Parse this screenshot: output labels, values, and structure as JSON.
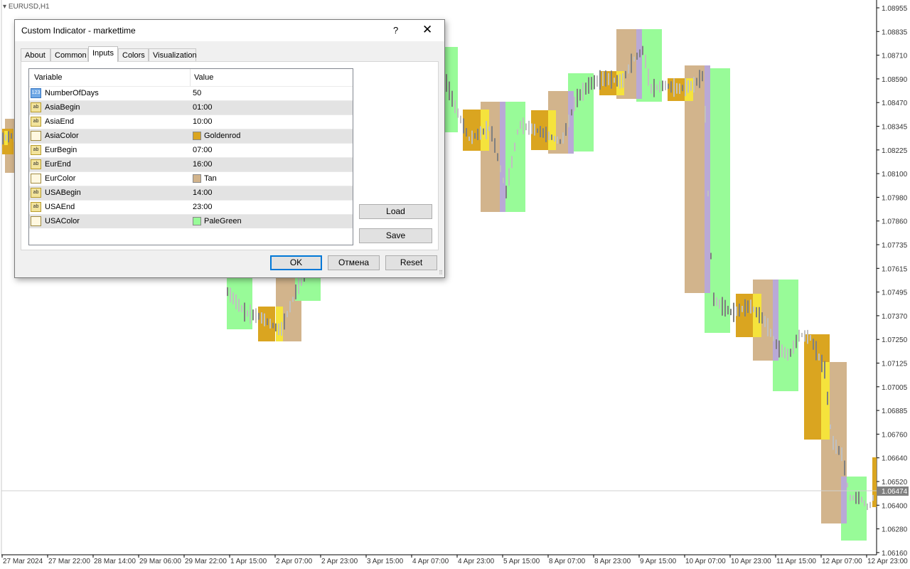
{
  "chart": {
    "symbol": "EURUSD,H1",
    "price_labels": [
      "1.08955",
      "1.08835",
      "1.08710",
      "1.08590",
      "1.08470",
      "1.08345",
      "1.08225",
      "1.08100",
      "1.07980",
      "1.07860",
      "1.07735",
      "1.07615",
      "1.07495",
      "1.07370",
      "1.07250",
      "1.07125",
      "1.07005",
      "1.06885",
      "1.06760",
      "1.06640",
      "1.06520",
      "1.06400",
      "1.06280",
      "1.06160"
    ],
    "current_price": "1.06474",
    "time_labels": [
      "27 Mar 2024",
      "27 Mar 22:00",
      "28 Mar 14:00",
      "29 Mar 06:00",
      "29 Mar 22:00",
      "1 Apr 15:00",
      "2 Apr 07:00",
      "2 Apr 23:00",
      "3 Apr 15:00",
      "4 Apr 07:00",
      "4 Apr 23:00",
      "5 Apr 15:00",
      "8 Apr 07:00",
      "8 Apr 23:00",
      "9 Apr 15:00",
      "10 Apr 07:00",
      "10 Apr 23:00",
      "11 Apr 15:00",
      "12 Apr 07:00",
      "12 Apr 23:00"
    ],
    "colors": {
      "asia": "#DAA520",
      "eur": "#D2B48C",
      "usa": "#98FB98",
      "overlap": "#F5E33C",
      "overlap2": "#B9A9D6",
      "bar": "#808080"
    }
  },
  "dialog": {
    "title": "Custom Indicator - markettime",
    "help": "?",
    "close": "✕",
    "tabs": [
      "About",
      "Common",
      "Inputs",
      "Colors",
      "Visualization"
    ],
    "active_tab": "Inputs",
    "header": {
      "variable": "Variable",
      "value": "Value"
    },
    "rows": [
      {
        "icon": "123",
        "name": "NumberOfDays",
        "value": "50"
      },
      {
        "icon": "ab",
        "name": "AsiaBegin",
        "value": "01:00"
      },
      {
        "icon": "ab",
        "name": "AsiaEnd",
        "value": "10:00"
      },
      {
        "icon": "color",
        "name": "AsiaColor",
        "value": "Goldenrod",
        "color": "#DAA520"
      },
      {
        "icon": "ab",
        "name": "EurBegin",
        "value": "07:00"
      },
      {
        "icon": "ab",
        "name": "EurEnd",
        "value": "16:00"
      },
      {
        "icon": "color",
        "name": "EurColor",
        "value": "Tan",
        "color": "#D2B48C"
      },
      {
        "icon": "ab",
        "name": "USABegin",
        "value": "14:00"
      },
      {
        "icon": "ab",
        "name": "USAEnd",
        "value": "23:00"
      },
      {
        "icon": "color",
        "name": "USAColor",
        "value": "PaleGreen",
        "color": "#98FB98"
      }
    ],
    "buttons": {
      "load": "Load",
      "save": "Save",
      "ok": "OK",
      "cancel": "Отмена",
      "reset": "Reset"
    }
  }
}
